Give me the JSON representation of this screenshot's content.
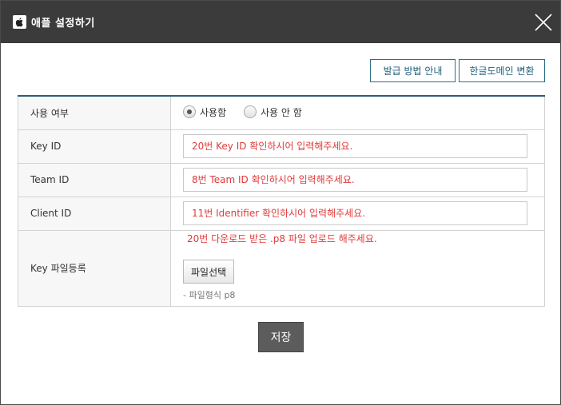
{
  "window": {
    "title": "애플 설정하기",
    "logo_icon": "apple-logo-icon",
    "close_icon": "close-icon"
  },
  "toolbar": {
    "guide_label": "발급 방법 안내",
    "domain_label": "한글도메인 변환"
  },
  "form": {
    "usage": {
      "label": "사용 여부",
      "options": [
        {
          "label": "사용함",
          "selected": true
        },
        {
          "label": "사용 안 함",
          "selected": false
        }
      ]
    },
    "key_id": {
      "label": "Key ID",
      "placeholder": "20번 Key ID 확인하시어 입력해주세요."
    },
    "team_id": {
      "label": "Team ID",
      "placeholder": "8번 Team ID 확인하시어 입력해주세요."
    },
    "client_id": {
      "label": "Client ID",
      "placeholder": "11번 Identifier 확인하시어 입력해주세요."
    },
    "key_file": {
      "label": "Key 파일등록",
      "note": "20번 다운로드 받은 .p8 파일 업로드 해주세요.",
      "button_label": "파일선택",
      "format_hint": "- 파일형식 p8"
    }
  },
  "footer": {
    "save_label": "저장"
  },
  "colors": {
    "title_bg": "#3b3b3b",
    "accent": "#2b5f78",
    "warning_text": "#e03a3a",
    "save_bg": "#5c5c5c"
  }
}
